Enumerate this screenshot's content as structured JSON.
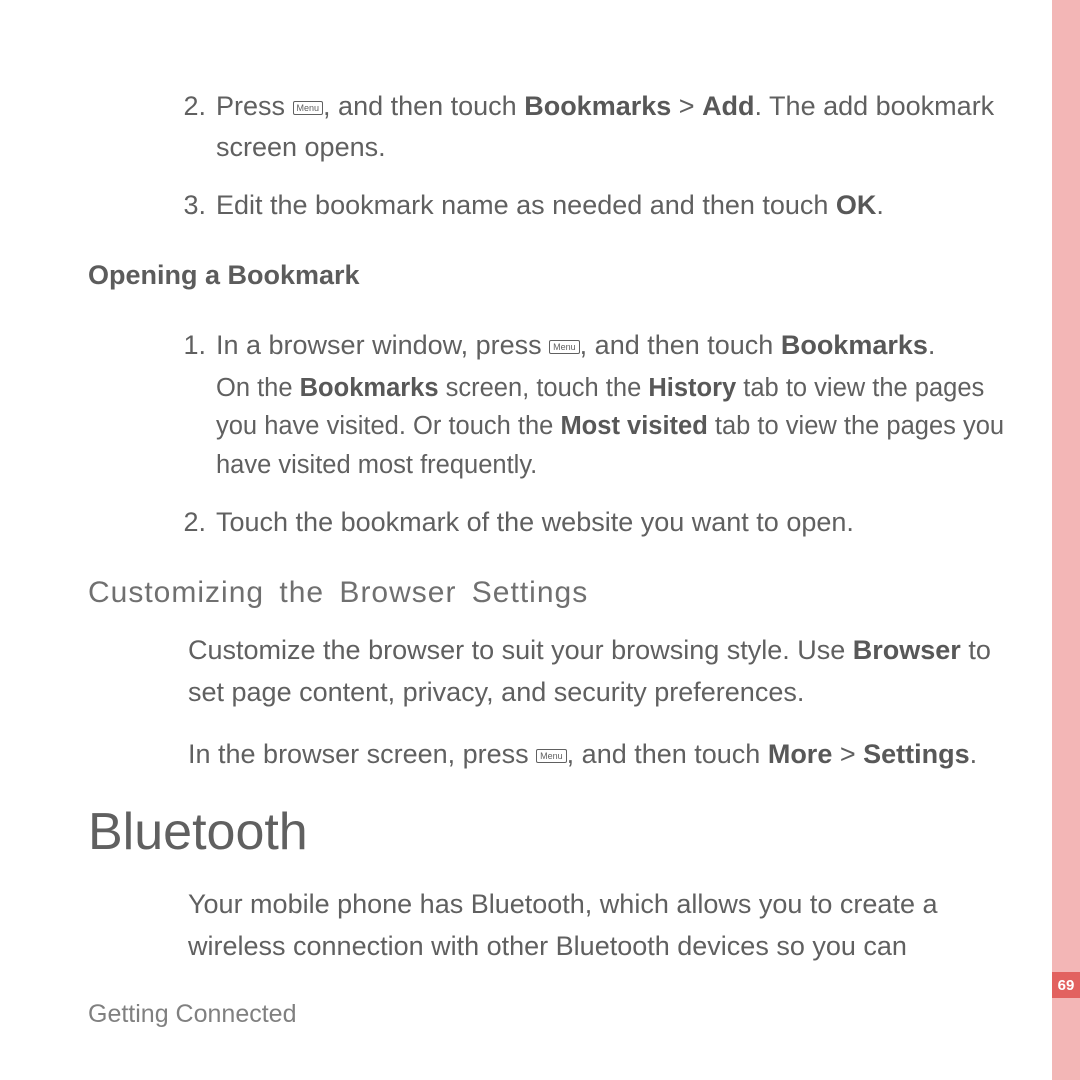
{
  "menu_key_label": "Menu",
  "steps_a": [
    {
      "num": "2. ",
      "pre": "Press ",
      "has_key": true,
      "post1": ", and then touch ",
      "bold1": "Bookmarks",
      "mid": " > ",
      "bold2": "Add",
      "post2": ". The add bookmark screen opens."
    },
    {
      "num": "3. ",
      "pre": "Edit the bookmark name as needed and then touch ",
      "bold1": "OK",
      "post1": "."
    }
  ],
  "heading_open": "Opening a Bookmark",
  "steps_b": [
    {
      "num": "1. ",
      "pre": "In a browser window, press ",
      "has_key": true,
      "post1": ", and then touch ",
      "bold1": "Bookmarks",
      "post2": ".",
      "sub_pre": "On the ",
      "sub_b1": "Bookmarks",
      "sub_mid1": " screen, touch the ",
      "sub_b2": "History",
      "sub_mid2": " tab to view the pages you have visited. Or touch the ",
      "sub_b3": "Most visited",
      "sub_post": " tab to view the pages you have visited most frequently."
    },
    {
      "num": "2. ",
      "pre": "Touch the bookmark of the website you want to open."
    }
  ],
  "heading_custom": "Customizing  the  Browser  Settings",
  "para1_pre": "Customize the browser to suit your browsing style. Use ",
  "para1_b": "Browser",
  "para1_post": " to set page content, privacy, and security preferences.",
  "para2_pre": "In the browser screen, press ",
  "para2_post1": ", and then touch ",
  "para2_b1": "More",
  "para2_mid": " > ",
  "para2_b2": "Settings",
  "para2_post2": ".",
  "heading_bt": "Bluetooth",
  "para_bt": "Your mobile phone has Bluetooth, which allows you to create a wireless connection with other Bluetooth devices so you can",
  "footer": "Getting Connected",
  "page_number": "69"
}
